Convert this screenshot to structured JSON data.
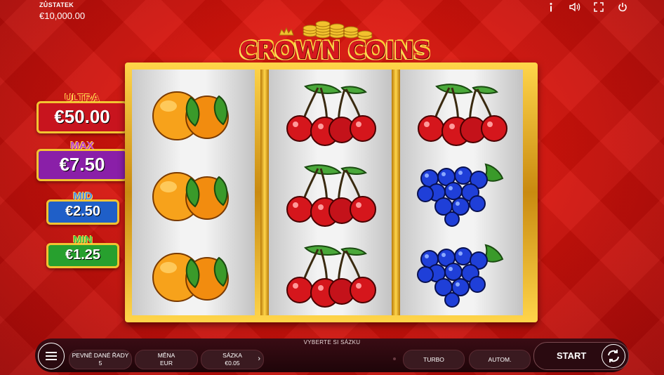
{
  "balance": {
    "label": "ZŮSTATEK",
    "value": "€10,000.00"
  },
  "top_icons": [
    "info-icon",
    "sound-icon",
    "fullscreen-icon",
    "power-icon"
  ],
  "logo": {
    "text": "CROWN COINS"
  },
  "jackpots": [
    {
      "name": "ULTRA",
      "value": "€50.00",
      "color": "#c8141e"
    },
    {
      "name": "MAX",
      "value": "€7.50",
      "color": "#8a1fa8"
    },
    {
      "name": "MID",
      "value": "€2.50",
      "color": "#1f5fc8"
    },
    {
      "name": "MIN",
      "value": "€1.25",
      "color": "#27a02e"
    }
  ],
  "reels": [
    [
      "orange",
      "orange",
      "orange"
    ],
    [
      "cherry",
      "cherry",
      "cherry"
    ],
    [
      "cherry",
      "grape",
      "grape"
    ]
  ],
  "controls": {
    "bet_hint": "VYBERTE SI SÁZKU",
    "fixed_lines": {
      "label": "PEVNĚ DANÉ ŘADY",
      "value": "5"
    },
    "currency": {
      "label": "MĚNA",
      "value": "EUR"
    },
    "bet": {
      "label": "SÁZKA",
      "value": "€0.05"
    },
    "turbo_label": "TURBO",
    "auto_label": "AUTOM.",
    "start_label": "START"
  }
}
